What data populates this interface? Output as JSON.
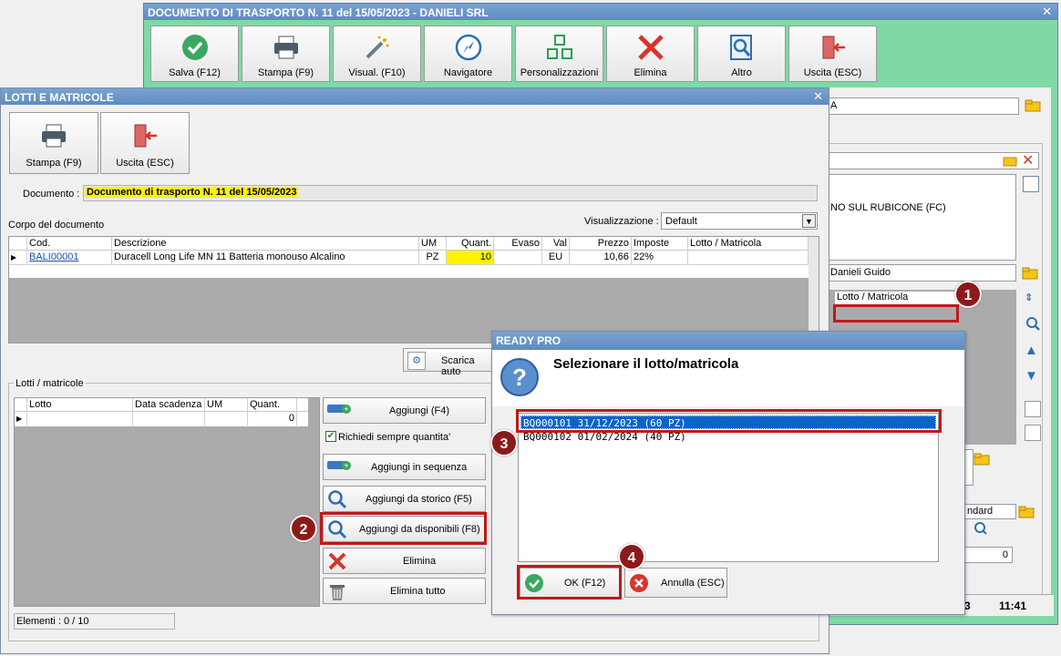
{
  "main_window": {
    "title": "DOCUMENTO DI TRASPORTO N. 11 del 15/05/2023 - DANIELI SRL",
    "toolbar": [
      {
        "label": "Salva (F12)",
        "icon": "check-circle-icon"
      },
      {
        "label": "Stampa (F9)",
        "icon": "printer-icon"
      },
      {
        "label": "Visual. (F10)",
        "icon": "magic-wand-icon"
      },
      {
        "label": "Navigatore",
        "icon": "compass-icon"
      },
      {
        "label": "Personalizzazioni",
        "icon": "grid-icon"
      },
      {
        "label": "Elimina",
        "icon": "x-icon"
      },
      {
        "label": "Altro",
        "icon": "magnifier-doc-icon"
      },
      {
        "label": "Uscita (ESC)",
        "icon": "exit-door-icon"
      }
    ],
    "partial_field_1": "A",
    "address_text": "NO SUL RUBICONE (FC)",
    "agent_field": "Danieli Guido",
    "lotto_header": "Lotto / Matricola",
    "standard_field": "ndard",
    "qty_field": "0",
    "status_left": "3",
    "clock": "11:41"
  },
  "lotti_window": {
    "title": "LOTTI E MATRICOLE",
    "stampa_label": "Stampa (F9)",
    "uscita_label": "Uscita (ESC)",
    "documento_label": "Documento :",
    "documento_value": "Documento di trasporto N. 11 del 15/05/2023",
    "corpo_label": "Corpo del documento",
    "visualizzazione_label": "Visualizzazione :",
    "visualizzazione_value": "Default",
    "grid_headers": [
      "Cod.",
      "Descrizione",
      "UM",
      "Quant.",
      "Evaso",
      "Val",
      "Prezzo",
      "Imposte",
      "Lotto / Matricola"
    ],
    "row": {
      "cod": "BALI00001",
      "descrizione": "Duracell Long Life MN 11 Batteria monouso Alcalino",
      "um": "PZ",
      "quant": "10",
      "evaso": "",
      "val": "EU",
      "prezzo": "10,66",
      "imposte": "22%",
      "lotto": ""
    },
    "scarica_label": "Scarica auto",
    "lotti_group_label": "Lotti / matricole",
    "lotti_headers": [
      "Lotto",
      "Data scadenza",
      "UM",
      "Quant."
    ],
    "lotti_row_quant": "0",
    "aggiungi_label": "Aggiungi (F4)",
    "richiedi_label": "Richiedi sempre quantita'",
    "sequenza_label": "Aggiungi in sequenza",
    "storico_label": "Aggiungi da storico (F5)",
    "disponibili_label": "Aggiungi da disponibili (F8)",
    "elimina_label": "Elimina",
    "elimina_tutto_label": "Elimina tutto",
    "elementi_label": "Elementi : 0 / 10"
  },
  "dialog": {
    "title": "READY PRO",
    "message": "Selezionare il lotto/matricola",
    "items": [
      "BQ000101 31/12/2023 (60 PZ)",
      "BQ000102 01/02/2024 (40 PZ)"
    ],
    "selected_index": 0,
    "ok_label": "OK (F12)",
    "annulla_label": "Annulla (ESC)"
  },
  "badges": [
    "1",
    "2",
    "3",
    "4"
  ],
  "colors": {
    "main_title_bg": "#5f8bbf",
    "accent_green": "#7fd9a4",
    "highlight_yellow": "#fff200",
    "selection_blue": "#0a64c8",
    "callout_red": "#c21818"
  }
}
